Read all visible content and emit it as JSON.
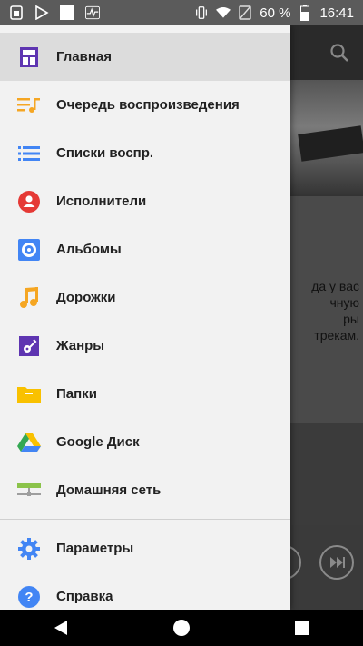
{
  "status_bar": {
    "battery_percent": "60 %",
    "time": "16:41"
  },
  "drawer": {
    "items": [
      {
        "label": "Главная",
        "icon": "home-icon",
        "color": "#5e35b1"
      },
      {
        "label": "Очередь воспроизведения",
        "icon": "queue-music-icon",
        "color": "#f5a623"
      },
      {
        "label": "Списки воспр.",
        "icon": "playlist-icon",
        "color": "#4285f4"
      },
      {
        "label": "Исполнители",
        "icon": "artist-icon",
        "color": "#e53935"
      },
      {
        "label": "Альбомы",
        "icon": "album-icon",
        "color": "#4285f4"
      },
      {
        "label": "Дорожки",
        "icon": "music-note-icon",
        "color": "#f5a623"
      },
      {
        "label": "Жанры",
        "icon": "guitar-icon",
        "color": "#5e35b1"
      },
      {
        "label": "Папки",
        "icon": "folder-icon",
        "color": "#f9c100"
      },
      {
        "label": "Google Диск",
        "icon": "google-drive-icon",
        "color": "#34a853"
      },
      {
        "label": "Домашняя сеть",
        "icon": "home-network-icon",
        "color": "#8bc34a"
      }
    ],
    "footer_items": [
      {
        "label": "Параметры",
        "icon": "gear-icon",
        "color": "#4285f4"
      },
      {
        "label": "Справка",
        "icon": "help-icon",
        "color": "#4285f4"
      }
    ]
  },
  "background": {
    "text_lines": [
      "да у вас",
      "чную",
      "ры",
      "трекам."
    ]
  }
}
